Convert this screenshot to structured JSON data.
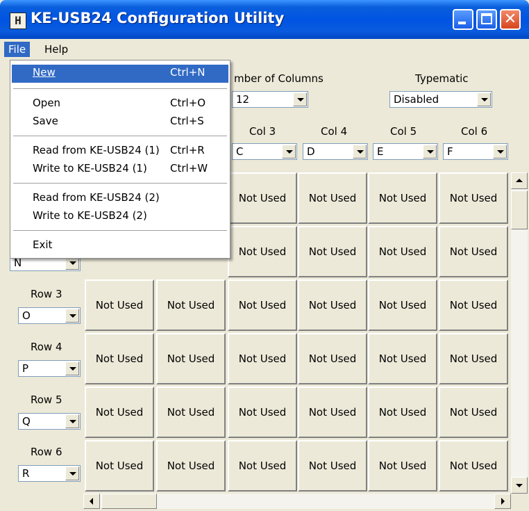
{
  "window": {
    "title": "KE-USB24 Configuration Utility",
    "icon": "H"
  },
  "menubar": {
    "file": "File",
    "help": "Help"
  },
  "file_menu": {
    "items": [
      {
        "label": "New",
        "shortcut": "Ctrl+N"
      },
      {
        "label": "Open",
        "shortcut": "Ctrl+O"
      },
      {
        "label": "Save",
        "shortcut": "Ctrl+S"
      },
      {
        "label": "Read from KE-USB24 (1)",
        "shortcut": "Ctrl+R"
      },
      {
        "label": "Write to KE-USB24 (1)",
        "shortcut": "Ctrl+W"
      },
      {
        "label": "Read from KE-USB24 (2)",
        "shortcut": ""
      },
      {
        "label": "Write to KE-USB24 (2)",
        "shortcut": ""
      },
      {
        "label": "Exit",
        "shortcut": ""
      }
    ]
  },
  "settings": {
    "columns_label": "mber of Columns",
    "columns_value": "12",
    "typematic_label": "Typematic",
    "typematic_value": "Disabled"
  },
  "columns": [
    {
      "label": "Col 3",
      "value": "C"
    },
    {
      "label": "Col 4",
      "value": "D"
    },
    {
      "label": "Col 5",
      "value": "E"
    },
    {
      "label": "Col 6",
      "value": "F"
    }
  ],
  "rows": [
    {
      "label": "",
      "value": "N"
    },
    {
      "label": "Row 3",
      "value": "O"
    },
    {
      "label": "Row 4",
      "value": "P"
    },
    {
      "label": "Row 5",
      "value": "Q"
    },
    {
      "label": "Row 6",
      "value": "R"
    }
  ],
  "cell_text": "Not Used"
}
